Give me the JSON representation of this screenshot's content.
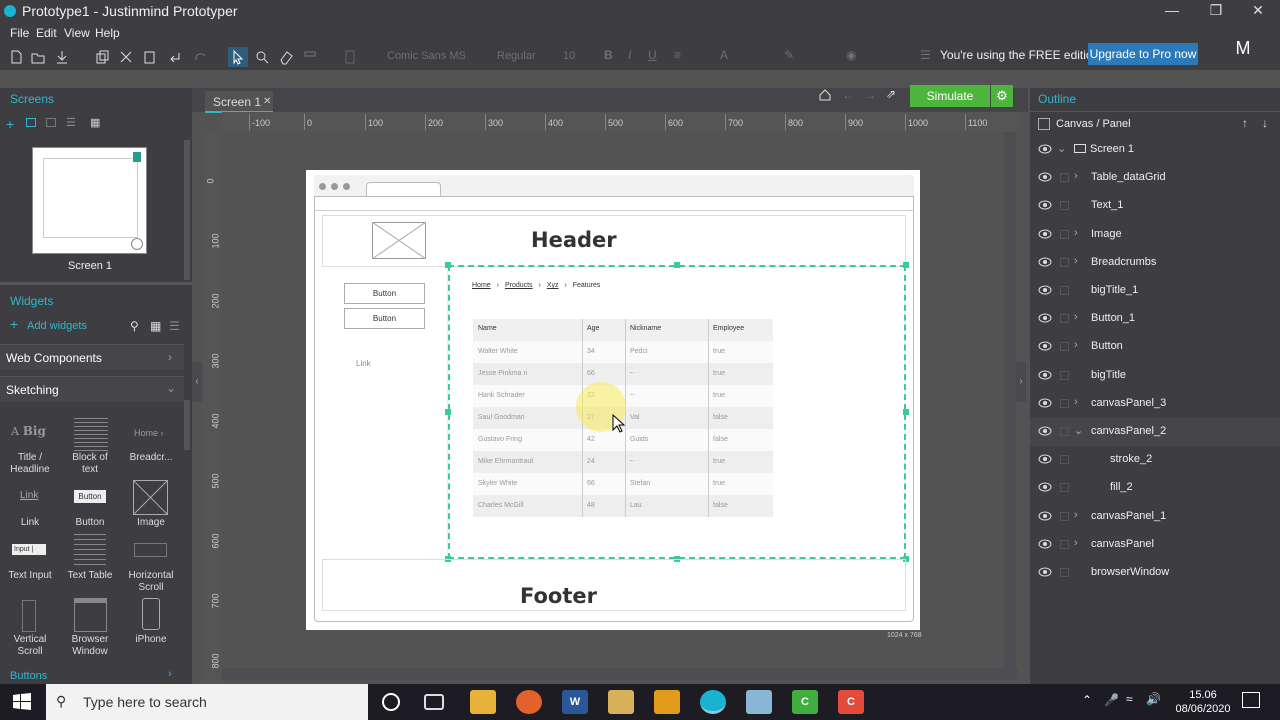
{
  "window": {
    "title": "Prototype1 - Justinmind Prototyper"
  },
  "menus": [
    "File",
    "Edit",
    "View",
    "Help"
  ],
  "toolbar": {
    "font": "Comic Sans MS",
    "weight": "Regular",
    "size": "10",
    "free_text": "You're using the FREE edition",
    "upgrade_label": "Upgrade to Pro now",
    "avatar": "M"
  },
  "screens_panel": {
    "title": "Screens",
    "screen_name": "Screen 1"
  },
  "widgets_panel": {
    "title": "Widgets",
    "add_label": "Add widgets",
    "categories": [
      "Web Components",
      "Sketching"
    ],
    "items": [
      {
        "label": "Title /\nHeadline",
        "icon": "A Big"
      },
      {
        "label": "Block of\ntext",
        "icon": "text-block-icon"
      },
      {
        "label": "Breadcr...",
        "icon": "Home ›"
      },
      {
        "label": "Link",
        "icon": "Link"
      },
      {
        "label": "Button",
        "icon": "Button"
      },
      {
        "label": "Image",
        "icon": "image-icon"
      },
      {
        "label": "Text Input",
        "icon": "Input |"
      },
      {
        "label": "Text Table",
        "icon": "table-icon"
      },
      {
        "label": "Horizontal\nScroll",
        "icon": "hscroll-icon"
      },
      {
        "label": "Vertical\nScroll",
        "icon": "vscroll-icon"
      },
      {
        "label": "Browser\nWindow",
        "icon": "browser-icon"
      },
      {
        "label": "iPhone",
        "icon": "iphone-icon"
      }
    ],
    "footer_category": "Buttons"
  },
  "canvas": {
    "tab": "Screen 1",
    "simulate_label": "Simulate",
    "hruler": [
      "-100",
      "0",
      "100",
      "200",
      "300",
      "400",
      "500",
      "600",
      "700",
      "800",
      "900",
      "1000",
      "1100"
    ],
    "vruler": [
      "0",
      "100",
      "200",
      "300",
      "400",
      "500",
      "600",
      "700",
      "800"
    ],
    "size_label": "1024 x 768"
  },
  "mockup": {
    "header": "Header",
    "footer": "Footer",
    "buttons": [
      "Button",
      "Button"
    ],
    "link": "Link",
    "breadcrumbs": [
      "Home",
      "Products",
      "Xyz",
      "Features"
    ],
    "table": {
      "columns": [
        "Name",
        "Age",
        "Nickname",
        "Employee"
      ],
      "rows": [
        [
          "Walter White",
          "34",
          "Pedci",
          "true"
        ],
        [
          "Jesse Pinkma n",
          "66",
          "--",
          "true"
        ],
        [
          "Hank Schrader",
          "22",
          "--",
          "true"
        ],
        [
          "Saul Goodman",
          "27",
          "Val",
          "false"
        ],
        [
          "Gustavo Fring",
          "42",
          "Guids",
          "false"
        ],
        [
          "Mike Ehrmantraut",
          "24",
          "--",
          "true"
        ],
        [
          "Skyler White",
          "66",
          "Stefan",
          "true"
        ],
        [
          "Charles McGill",
          "48",
          "Lau",
          "false"
        ]
      ]
    }
  },
  "outline": {
    "title": "Outline",
    "breadcrumb": "Canvas / Panel",
    "items": [
      {
        "label": "Screen 1",
        "expander": "v"
      },
      {
        "label": "Table_dataGrid",
        "expander": ">"
      },
      {
        "label": "Text_1",
        "expander": ""
      },
      {
        "label": "Image",
        "expander": ">"
      },
      {
        "label": "Breadcrumbs",
        "expander": ">"
      },
      {
        "label": "bigTitle_1",
        "expander": ""
      },
      {
        "label": "Button_1",
        "expander": ">"
      },
      {
        "label": "Button",
        "expander": ">"
      },
      {
        "label": "bigTitle",
        "expander": ""
      },
      {
        "label": "canvasPanel_3",
        "expander": ">"
      },
      {
        "label": "canvasPanel_2",
        "expander": "v"
      },
      {
        "label": "stroke_2",
        "expander": ""
      },
      {
        "label": "fill_2",
        "expander": ""
      },
      {
        "label": "canvasPanel_1",
        "expander": ">"
      },
      {
        "label": "canvasPanel",
        "expander": ">"
      },
      {
        "label": "browserWindow",
        "expander": ""
      }
    ]
  },
  "taskbar": {
    "search_placeholder": "Type here to search",
    "time": "15.06",
    "date": "08/06/2020"
  },
  "colors": {
    "accent": "#2fb7cf",
    "simulate": "#4eb53c",
    "upgrade": "#2d7ab8",
    "selection": "#3bc9a0"
  }
}
